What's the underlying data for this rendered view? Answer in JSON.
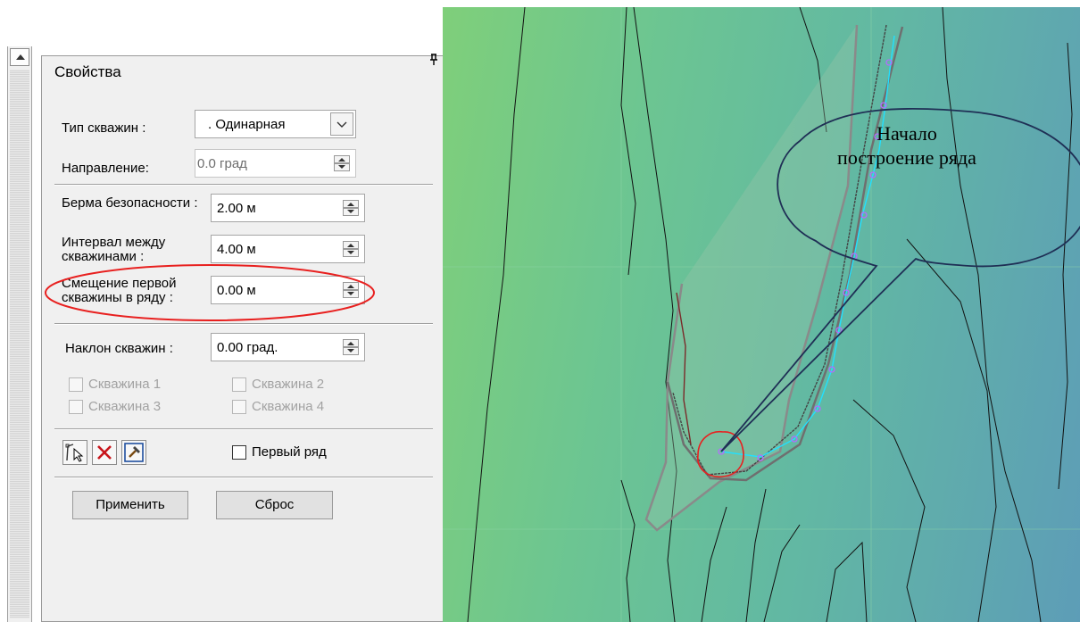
{
  "panel": {
    "title": "Свойства",
    "pin_icon": "pin-icon",
    "well_type_label": "Тип скважин :",
    "well_type_value": ". Одинарная",
    "direction_label": "Направление:",
    "direction_value": "0.0 град",
    "berm_label": "Берма безопасности :",
    "berm_value": "2.00 м",
    "interval_label": "Интервал между скважинами :",
    "interval_value": "4.00 м",
    "offset_label": "Смещение первой скважины в ряду :",
    "offset_value": "0.00 м",
    "tilt_label": "Наклон скважин :",
    "tilt_value": "0.00 град.",
    "well1": "Скважина 1",
    "well2": "Скважина 2",
    "well3": "Скважина 3",
    "well4": "Скважина 4",
    "first_row_label": "Первый ряд",
    "apply_label": "Применить",
    "reset_label": "Сброс",
    "highlight_color": "#e8201f"
  },
  "map": {
    "callout_text": "Начало построение ряда",
    "row_line_color": "#22e0ff",
    "point_color": "#b46bff"
  }
}
